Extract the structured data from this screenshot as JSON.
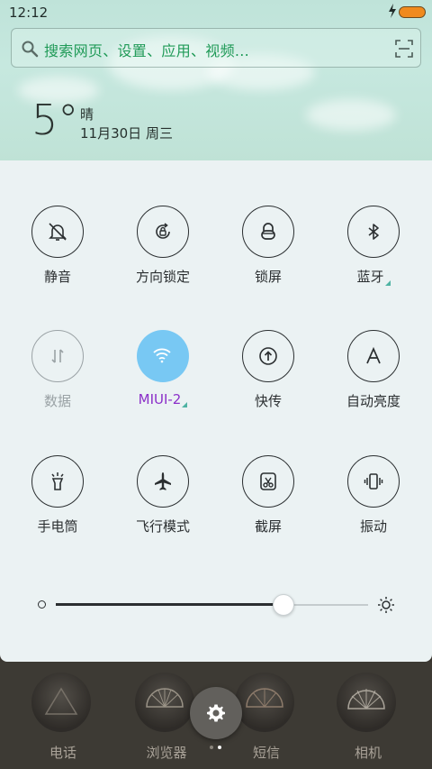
{
  "status_bar": {
    "time": "12:12",
    "battery_color": "#f08a1d"
  },
  "search": {
    "placeholder": "搜索网页、设置、应用、视频...",
    "icon": "search-icon",
    "scan_icon": "scan-icon"
  },
  "weather": {
    "temperature": "5°",
    "condition": "晴",
    "date": "11月30日 周三"
  },
  "toggles": [
    {
      "label": "静音",
      "icon": "mute-bell-icon",
      "state": "off"
    },
    {
      "label": "方向锁定",
      "icon": "rotation-lock-icon",
      "state": "off"
    },
    {
      "label": "锁屏",
      "icon": "lock-icon",
      "state": "off"
    },
    {
      "label": "蓝牙",
      "icon": "bluetooth-icon",
      "state": "off",
      "has_submenu": true
    },
    {
      "label": "数据",
      "icon": "mobile-data-icon",
      "state": "disabled"
    },
    {
      "label": "MIUI-2",
      "icon": "wifi-icon",
      "state": "on",
      "has_submenu": true
    },
    {
      "label": "快传",
      "icon": "quick-transfer-icon",
      "state": "off"
    },
    {
      "label": "自动亮度",
      "icon": "auto-brightness-icon",
      "state": "off"
    },
    {
      "label": "手电筒",
      "icon": "flashlight-icon",
      "state": "off"
    },
    {
      "label": "飞行模式",
      "icon": "airplane-icon",
      "state": "off"
    },
    {
      "label": "截屏",
      "icon": "screenshot-icon",
      "state": "off"
    },
    {
      "label": "振动",
      "icon": "vibrate-icon",
      "state": "off"
    }
  ],
  "brightness": {
    "level": 0.73
  },
  "dock": {
    "apps": [
      {
        "label": "电话",
        "icon": "phone-app-icon"
      },
      {
        "label": "浏览器",
        "icon": "browser-app-icon"
      },
      {
        "label": "短信",
        "icon": "messages-app-icon"
      },
      {
        "label": "相机",
        "icon": "camera-app-icon"
      }
    ],
    "settings_icon": "gear-icon",
    "pages": {
      "count": 2,
      "current": 2
    }
  },
  "colors": {
    "accent_on": "#78c8f3",
    "wifi_label": "#8b2fc9",
    "search_text": "#1f9a57"
  }
}
